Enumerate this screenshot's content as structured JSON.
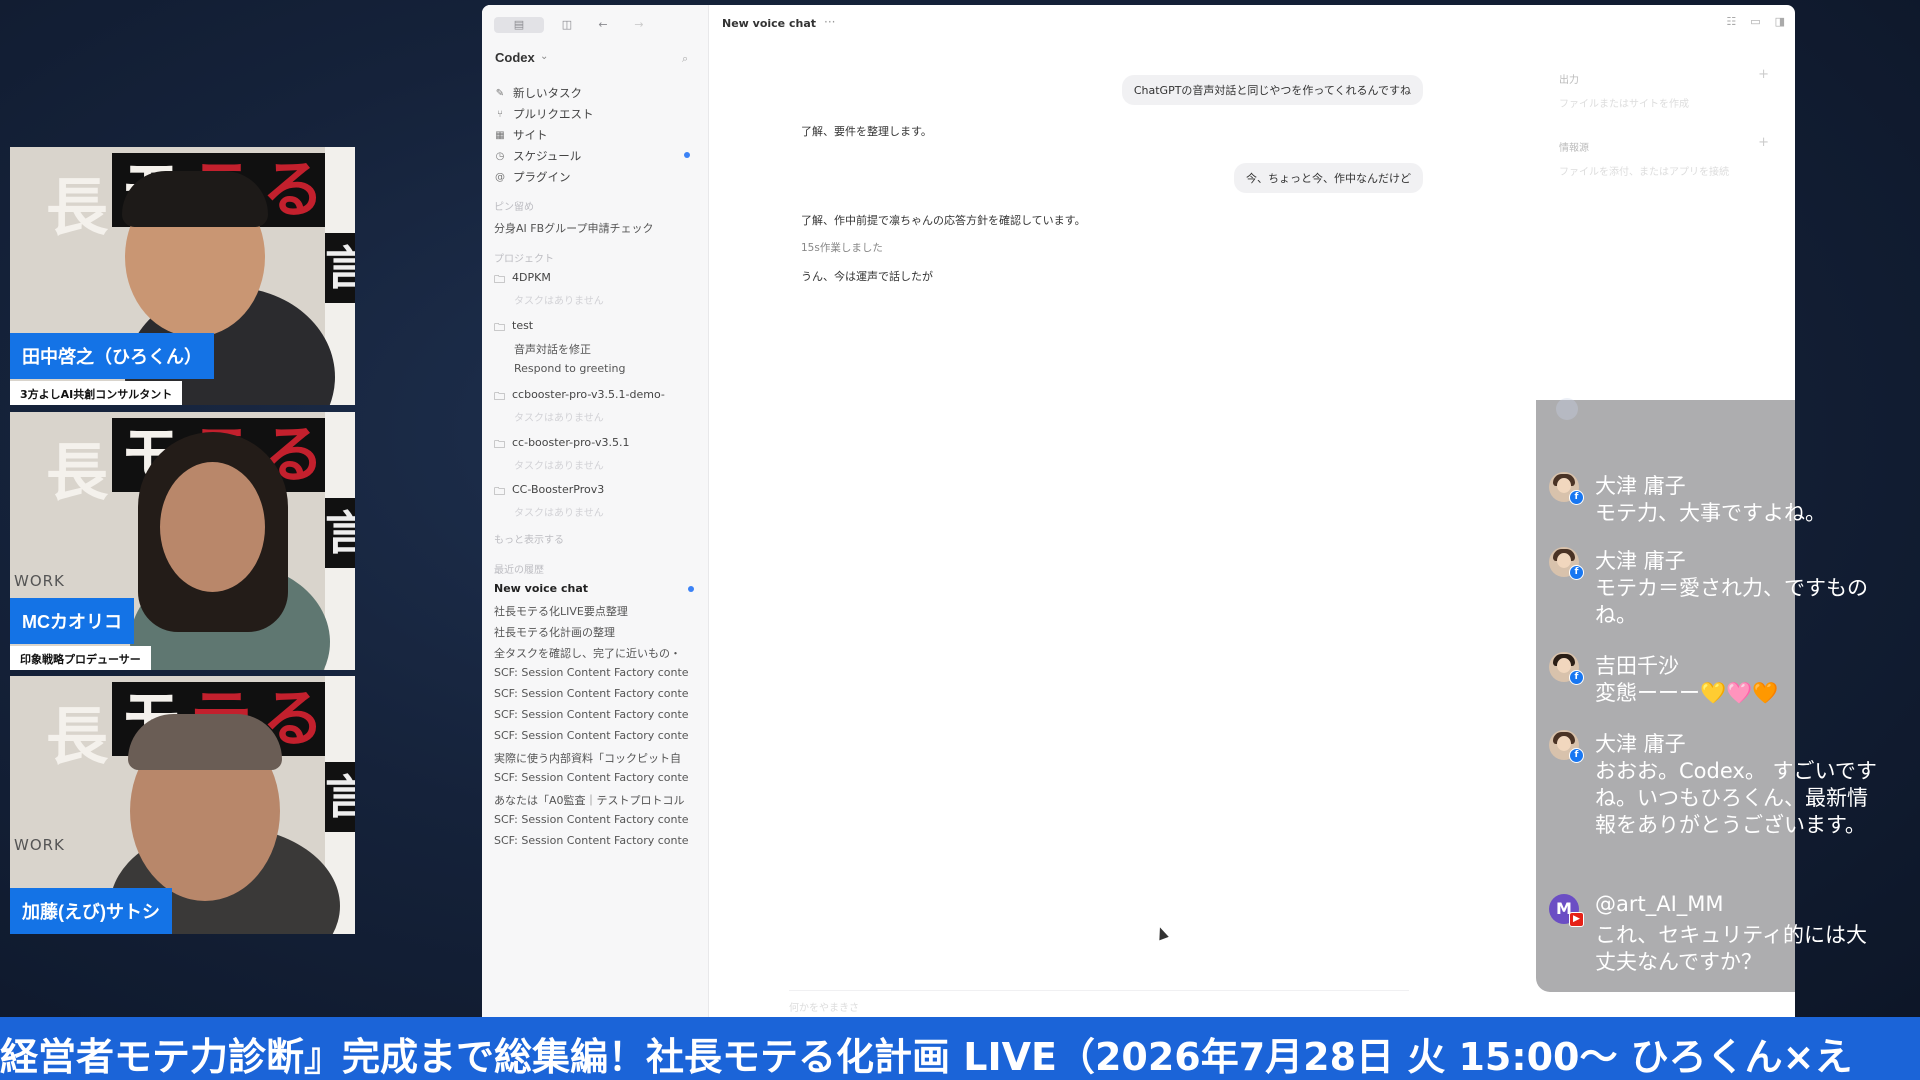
{
  "participants": [
    {
      "name": "田中啓之（ひろくん）",
      "role": "3方よしAI共創コンサルタント"
    },
    {
      "name": "MCカオリコ",
      "role": "印象戦略プロデューサー"
    },
    {
      "name": "加藤(えび)サトシ",
      "role": ""
    }
  ],
  "tile_bg": {
    "k1": "長",
    "k2": "モ",
    "k3": "テ",
    "k4": "る",
    "side1": "言",
    "side2": "画",
    "work": "WORK"
  },
  "app": {
    "brand": "Codex",
    "nav": [
      {
        "icon": "edit-icon",
        "label": "新しいタスク"
      },
      {
        "icon": "pull-request-icon",
        "label": "プルリクエスト"
      },
      {
        "icon": "site-icon",
        "label": "サイト"
      },
      {
        "icon": "clock-icon",
        "label": "スケジュール"
      },
      {
        "icon": "plugin-icon",
        "label": "プラグイン"
      }
    ],
    "pinned_header": "ピン留め",
    "pinned_item": "分身AI FBグループ申請チェック",
    "projects_header": "プロジェクト",
    "projects": [
      {
        "name": "4DPKM",
        "sub": [],
        "ghost": "タスクはありません"
      },
      {
        "name": "test",
        "sub": [
          "音声対話を修正",
          "Respond to greeting"
        ],
        "ghost": ""
      },
      {
        "name": "ccbooster-pro-v3.5.1-demo-",
        "sub": [],
        "ghost": "タスクはありません"
      },
      {
        "name": "cc-booster-pro-v3.5.1",
        "sub": [],
        "ghost": "タスクはありません"
      },
      {
        "name": "CC-BoosterProv3",
        "sub": [],
        "ghost": "タスクはありません"
      }
    ],
    "show_more": "もっと表示する",
    "recent_header": "最近の履歴",
    "recent": [
      "New voice chat",
      "社長モテる化LIVE要点整理",
      "社長モテる化計画の整理",
      "全タスクを確認し、完了に近いもの・",
      "SCF: Session Content Factory conte",
      "SCF: Session Content Factory conte",
      "SCF: Session Content Factory conte",
      "SCF: Session Content Factory conte",
      "実際に使う内部資料「コックピット自",
      "SCF: Session Content Factory conte",
      "あなたは「A0監査｜テストプロトコル",
      "SCF: Session Content Factory conte",
      "SCF: Session Content Factory conte"
    ],
    "chat_title": "New voice chat",
    "messages": {
      "user1": "ChatGPTの音声対話と同じやつを作ってくれるんですね",
      "ai1": "了解、要件を整理します。",
      "user2": "今、ちょっと今、作中なんだけど",
      "ai2": "了解、作中前提で凛ちゃんの応答方針を確認しています。",
      "ai2_meta": "15s作業しました",
      "ai3": "うん、今は運声で話したが"
    },
    "right_panel": {
      "output_h": "出力",
      "output_sub": "ファイルまたはサイトを作成",
      "source_h": "情報源",
      "source_sub": "ファイルを添付、またはアプリを接続"
    },
    "composer_placeholder": "何かをやまきさ"
  },
  "comments": [
    {
      "name": "大津 庸子",
      "text": "モテ力、大事ですよね。",
      "platform": "facebook"
    },
    {
      "name": "大津 庸子",
      "text": "モテカ＝愛され力、ですものね。",
      "platform": "facebook"
    },
    {
      "name": "吉田千沙",
      "text": "変態ーーー💛🩷🧡",
      "platform": "facebook"
    },
    {
      "name": "大津 庸子",
      "text": "おおお。Codex。 すごいですね。いつもひろくん、最新情報をありがとうございます。",
      "platform": "facebook"
    },
    {
      "name": "@art_AI_MM",
      "text": "これ、セキュリティ的には大丈夫なんですか？",
      "platform": "youtube",
      "initial": "M"
    }
  ],
  "ticker": "経営者モテ力診断』完成まで総集編！社長モテる化計画 LIVE（2026年7月28日 火 15:00〜 ひろくん×え",
  "colors": {
    "label_blue": "#1473e6",
    "ticker_blue": "#1b64d8",
    "fb": "#1877f2",
    "yt": "#e62117"
  }
}
